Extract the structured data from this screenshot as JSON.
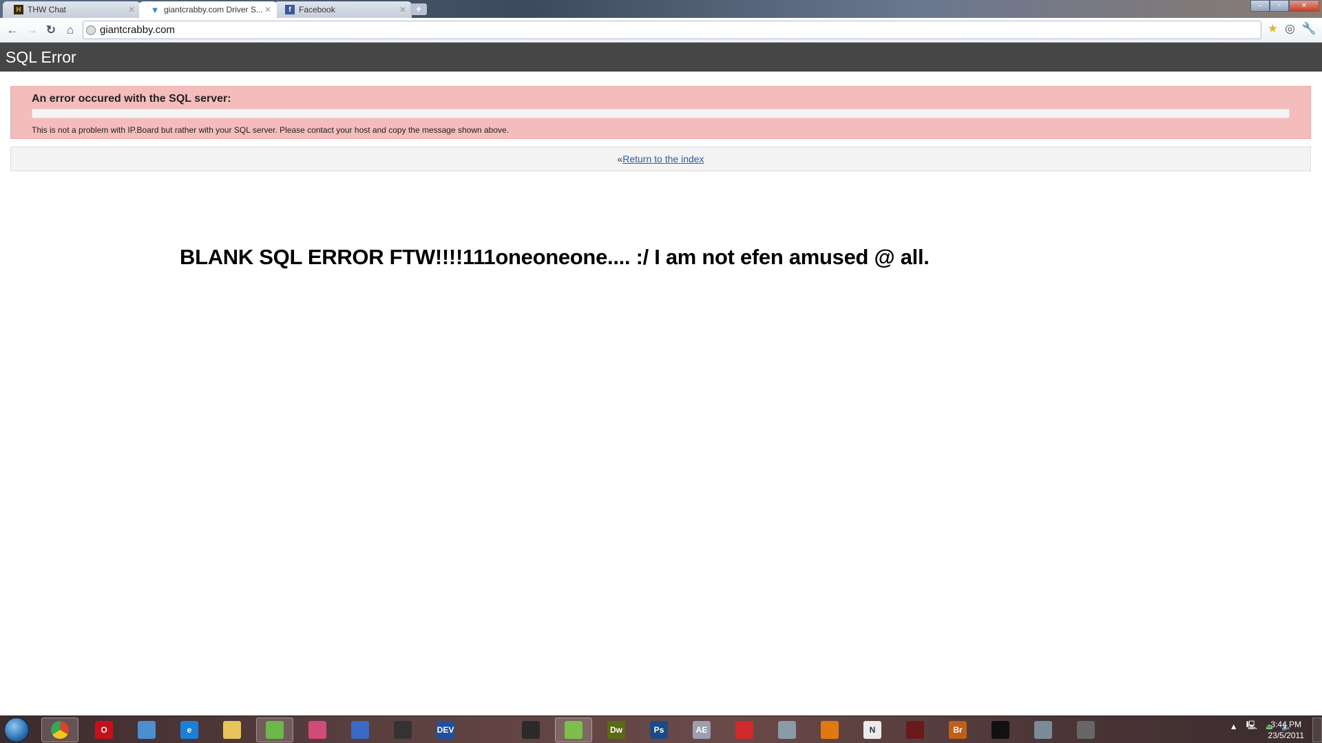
{
  "browser": {
    "tabs": [
      {
        "label": "THW Chat",
        "icon": "thw-favicon",
        "active": false
      },
      {
        "label": "giantcrabby.com Driver S...",
        "icon": "giantcrabby-favicon",
        "active": true
      },
      {
        "label": "Facebook",
        "icon": "facebook-favicon",
        "active": false
      }
    ],
    "new_tab_label": "+",
    "address": "giantcrabby.com"
  },
  "page": {
    "header_title": "SQL Error",
    "error_heading": "An error occured with the SQL server:",
    "error_message": "",
    "error_note": "This is not a problem with IP.Board but rather with your SQL server. Please contact your host and copy the message shown above.",
    "return_prefix": "«",
    "return_link": "Return to the index",
    "comment": "BLANK SQL ERROR FTW!!!!111oneoneone.... :/ I am not efen amused @ all."
  },
  "taskbar": {
    "apps": [
      {
        "name": "chrome",
        "label": "",
        "color": "#d8432f",
        "open": true
      },
      {
        "name": "opera",
        "label": "O",
        "color": "#c8101a",
        "open": false
      },
      {
        "name": "safari",
        "label": "",
        "color": "#4a8fd0",
        "open": false
      },
      {
        "name": "internet-explorer",
        "label": "e",
        "color": "#1b7fd8",
        "open": false
      },
      {
        "name": "windows-explorer",
        "label": "",
        "color": "#e8c35a",
        "open": false
      },
      {
        "name": "windows-live-messenger",
        "label": "",
        "color": "#6cb84a",
        "open": true
      },
      {
        "name": "app-colored-cubes",
        "label": "",
        "color": "#d04a7a",
        "open": false
      },
      {
        "name": "app-blue-pen",
        "label": "",
        "color": "#3a6ac8",
        "open": false
      },
      {
        "name": "steam",
        "label": "",
        "color": "#333333",
        "open": false
      },
      {
        "name": "dev-cpp",
        "label": "DEV",
        "color": "#1f4fa0",
        "open": false
      },
      {
        "name": "app-red-swirl",
        "label": "",
        "color": "#2a2a2a",
        "open": false
      },
      {
        "name": "notepad-plus-plus",
        "label": "",
        "color": "#7ac04a",
        "open": true
      },
      {
        "name": "dreamweaver",
        "label": "Dw",
        "color": "#5a6a10",
        "open": false
      },
      {
        "name": "photoshop",
        "label": "Ps",
        "color": "#1a4a8a",
        "open": false
      },
      {
        "name": "after-effects",
        "label": "AE",
        "color": "#9aa0b0",
        "open": false
      },
      {
        "name": "app-red-check",
        "label": "",
        "color": "#d02a2a",
        "open": false
      },
      {
        "name": "app-calculator",
        "label": "",
        "color": "#8a9aa8",
        "open": false
      },
      {
        "name": "media-player",
        "label": "",
        "color": "#e07a10",
        "open": false
      },
      {
        "name": "app-n",
        "label": "N",
        "color": "#eaeaea",
        "open": false
      },
      {
        "name": "app-film",
        "label": "",
        "color": "#6a1a1a",
        "open": false
      },
      {
        "name": "bridge",
        "label": "Br",
        "color": "#c06018",
        "open": false
      },
      {
        "name": "app-dots",
        "label": "",
        "color": "#111111",
        "open": false
      },
      {
        "name": "app-device",
        "label": "",
        "color": "#7a8a98",
        "open": false
      },
      {
        "name": "app-lightning",
        "label": "",
        "color": "#666666",
        "open": false
      }
    ],
    "tray_icons": [
      "show-hidden-icons",
      "network-icon",
      "disc-eject-icon",
      "volume-icon"
    ],
    "time": "3:44 PM",
    "date": "23/5/2011"
  }
}
